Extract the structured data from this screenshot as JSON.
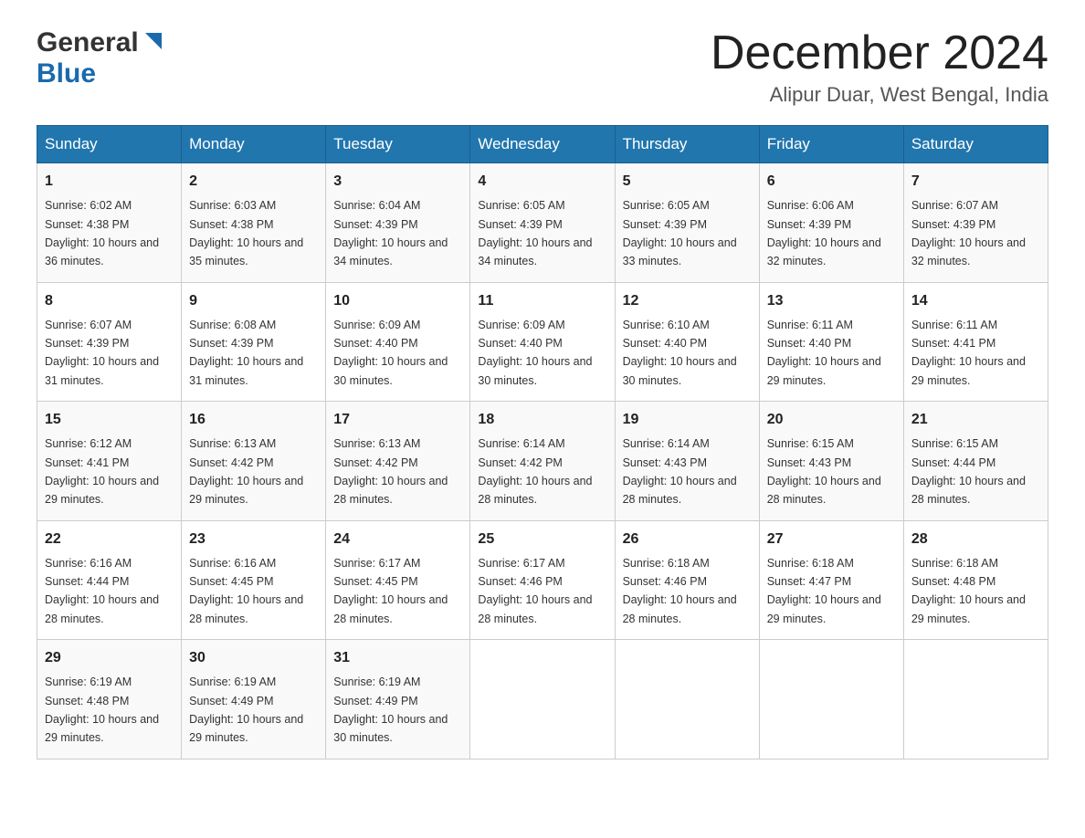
{
  "header": {
    "logo_line1": "General",
    "logo_line2": "Blue",
    "month_year": "December 2024",
    "location": "Alipur Duar, West Bengal, India"
  },
  "days_of_week": [
    "Sunday",
    "Monday",
    "Tuesday",
    "Wednesday",
    "Thursday",
    "Friday",
    "Saturday"
  ],
  "weeks": [
    [
      {
        "day": "1",
        "sunrise": "6:02 AM",
        "sunset": "4:38 PM",
        "daylight": "10 hours and 36 minutes."
      },
      {
        "day": "2",
        "sunrise": "6:03 AM",
        "sunset": "4:38 PM",
        "daylight": "10 hours and 35 minutes."
      },
      {
        "day": "3",
        "sunrise": "6:04 AM",
        "sunset": "4:39 PM",
        "daylight": "10 hours and 34 minutes."
      },
      {
        "day": "4",
        "sunrise": "6:05 AM",
        "sunset": "4:39 PM",
        "daylight": "10 hours and 34 minutes."
      },
      {
        "day": "5",
        "sunrise": "6:05 AM",
        "sunset": "4:39 PM",
        "daylight": "10 hours and 33 minutes."
      },
      {
        "day": "6",
        "sunrise": "6:06 AM",
        "sunset": "4:39 PM",
        "daylight": "10 hours and 32 minutes."
      },
      {
        "day": "7",
        "sunrise": "6:07 AM",
        "sunset": "4:39 PM",
        "daylight": "10 hours and 32 minutes."
      }
    ],
    [
      {
        "day": "8",
        "sunrise": "6:07 AM",
        "sunset": "4:39 PM",
        "daylight": "10 hours and 31 minutes."
      },
      {
        "day": "9",
        "sunrise": "6:08 AM",
        "sunset": "4:39 PM",
        "daylight": "10 hours and 31 minutes."
      },
      {
        "day": "10",
        "sunrise": "6:09 AM",
        "sunset": "4:40 PM",
        "daylight": "10 hours and 30 minutes."
      },
      {
        "day": "11",
        "sunrise": "6:09 AM",
        "sunset": "4:40 PM",
        "daylight": "10 hours and 30 minutes."
      },
      {
        "day": "12",
        "sunrise": "6:10 AM",
        "sunset": "4:40 PM",
        "daylight": "10 hours and 30 minutes."
      },
      {
        "day": "13",
        "sunrise": "6:11 AM",
        "sunset": "4:40 PM",
        "daylight": "10 hours and 29 minutes."
      },
      {
        "day": "14",
        "sunrise": "6:11 AM",
        "sunset": "4:41 PM",
        "daylight": "10 hours and 29 minutes."
      }
    ],
    [
      {
        "day": "15",
        "sunrise": "6:12 AM",
        "sunset": "4:41 PM",
        "daylight": "10 hours and 29 minutes."
      },
      {
        "day": "16",
        "sunrise": "6:13 AM",
        "sunset": "4:42 PM",
        "daylight": "10 hours and 29 minutes."
      },
      {
        "day": "17",
        "sunrise": "6:13 AM",
        "sunset": "4:42 PM",
        "daylight": "10 hours and 28 minutes."
      },
      {
        "day": "18",
        "sunrise": "6:14 AM",
        "sunset": "4:42 PM",
        "daylight": "10 hours and 28 minutes."
      },
      {
        "day": "19",
        "sunrise": "6:14 AM",
        "sunset": "4:43 PM",
        "daylight": "10 hours and 28 minutes."
      },
      {
        "day": "20",
        "sunrise": "6:15 AM",
        "sunset": "4:43 PM",
        "daylight": "10 hours and 28 minutes."
      },
      {
        "day": "21",
        "sunrise": "6:15 AM",
        "sunset": "4:44 PM",
        "daylight": "10 hours and 28 minutes."
      }
    ],
    [
      {
        "day": "22",
        "sunrise": "6:16 AM",
        "sunset": "4:44 PM",
        "daylight": "10 hours and 28 minutes."
      },
      {
        "day": "23",
        "sunrise": "6:16 AM",
        "sunset": "4:45 PM",
        "daylight": "10 hours and 28 minutes."
      },
      {
        "day": "24",
        "sunrise": "6:17 AM",
        "sunset": "4:45 PM",
        "daylight": "10 hours and 28 minutes."
      },
      {
        "day": "25",
        "sunrise": "6:17 AM",
        "sunset": "4:46 PM",
        "daylight": "10 hours and 28 minutes."
      },
      {
        "day": "26",
        "sunrise": "6:18 AM",
        "sunset": "4:46 PM",
        "daylight": "10 hours and 28 minutes."
      },
      {
        "day": "27",
        "sunrise": "6:18 AM",
        "sunset": "4:47 PM",
        "daylight": "10 hours and 29 minutes."
      },
      {
        "day": "28",
        "sunrise": "6:18 AM",
        "sunset": "4:48 PM",
        "daylight": "10 hours and 29 minutes."
      }
    ],
    [
      {
        "day": "29",
        "sunrise": "6:19 AM",
        "sunset": "4:48 PM",
        "daylight": "10 hours and 29 minutes."
      },
      {
        "day": "30",
        "sunrise": "6:19 AM",
        "sunset": "4:49 PM",
        "daylight": "10 hours and 29 minutes."
      },
      {
        "day": "31",
        "sunrise": "6:19 AM",
        "sunset": "4:49 PM",
        "daylight": "10 hours and 30 minutes."
      },
      null,
      null,
      null,
      null
    ]
  ]
}
